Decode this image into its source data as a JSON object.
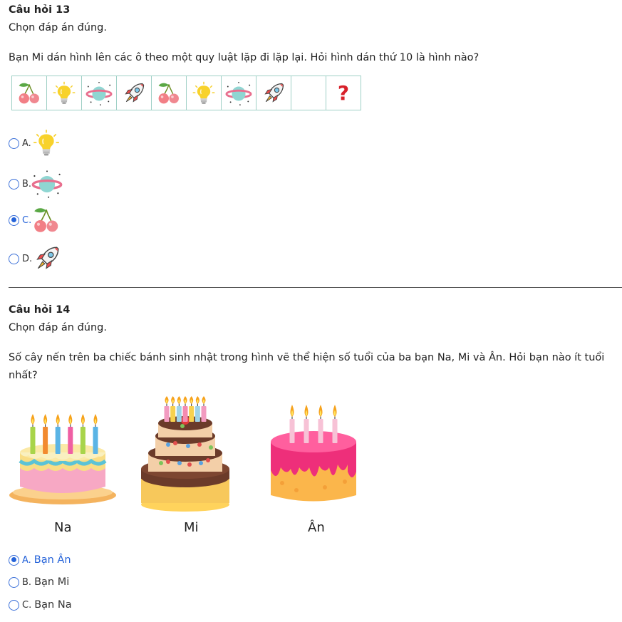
{
  "q13": {
    "title": "Câu hỏi 13",
    "instruction": "Chọn đáp án đúng.",
    "text": "Bạn Mi dán hình lên các ô theo một quy luật lặp đi lặp lại. Hỏi hình dán thứ 10 là hình nào?",
    "sequence": [
      "cherry-icon",
      "bulb-icon",
      "planet-icon",
      "rocket-icon",
      "cherry-icon",
      "bulb-icon",
      "planet-icon",
      "rocket-icon",
      "empty",
      "question"
    ],
    "question_mark": "?",
    "options": [
      {
        "letter": "A.",
        "icon": "bulb-icon",
        "selected": false
      },
      {
        "letter": "B.",
        "icon": "planet-icon",
        "selected": false
      },
      {
        "letter": "C.",
        "icon": "cherry-icon",
        "selected": true
      },
      {
        "letter": "D.",
        "icon": "rocket-icon",
        "selected": false
      }
    ]
  },
  "q14": {
    "title": "Câu hỏi 14",
    "instruction": "Chọn đáp án đúng.",
    "text_line1": "Số cây nến trên ba chiếc bánh sinh nhật trong hình vẽ thể hiện số tuổi của ba bạn Na, Mi và Ân. Hỏi bạn nào ít tuổi",
    "text_line2": "nhất?",
    "cakes": [
      {
        "label": "Na",
        "candles": 6
      },
      {
        "label": "Mi",
        "candles": 7
      },
      {
        "label": "Ân",
        "candles": 4
      }
    ],
    "options": [
      {
        "letter": "A.",
        "text": "Bạn Ân",
        "selected": true
      },
      {
        "letter": "B.",
        "text": "Bạn Mi",
        "selected": false
      },
      {
        "letter": "C.",
        "text": "Bạn Na",
        "selected": false
      }
    ]
  },
  "colors": {
    "accent": "#2563d9",
    "question_mark": "#d8202a",
    "table_border": "#9fd0c6"
  }
}
